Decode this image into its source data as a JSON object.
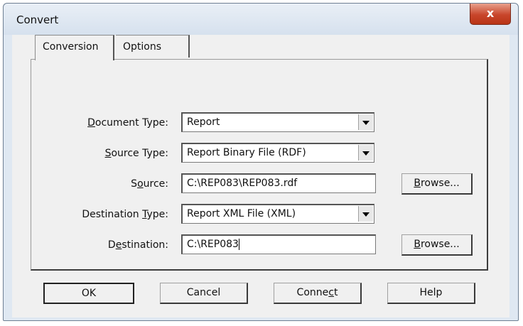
{
  "window": {
    "title": "Convert",
    "close_glyph": "x"
  },
  "tabs": [
    {
      "label": "Conversion"
    },
    {
      "label": "Options"
    }
  ],
  "form": {
    "document_type": {
      "label_pre": "",
      "label_u": "D",
      "label_post": "ocument Type:",
      "value": "Report"
    },
    "source_type": {
      "label_pre": "",
      "label_u": "S",
      "label_post": "ource Type:",
      "value": "Report Binary File (RDF)"
    },
    "source": {
      "label_pre": "S",
      "label_u": "o",
      "label_post": "urce:",
      "value": "C:\\REP083\\REP083.rdf"
    },
    "destination_type": {
      "label_pre": "Destination ",
      "label_u": "T",
      "label_post": "ype:",
      "value": "Report XML File (XML)"
    },
    "destination": {
      "label_pre": "D",
      "label_u": "e",
      "label_post": "stination:",
      "value": "C:\\REP083"
    }
  },
  "browse": {
    "pre": "",
    "u": "B",
    "post": "rowse..."
  },
  "buttons": {
    "ok": "OK",
    "cancel": "Cancel",
    "connect": {
      "pre": "Conne",
      "u": "c",
      "post": "t"
    },
    "help": "Help"
  },
  "icons": {
    "dropdown": "chevron-down-icon",
    "close": "close-icon"
  }
}
